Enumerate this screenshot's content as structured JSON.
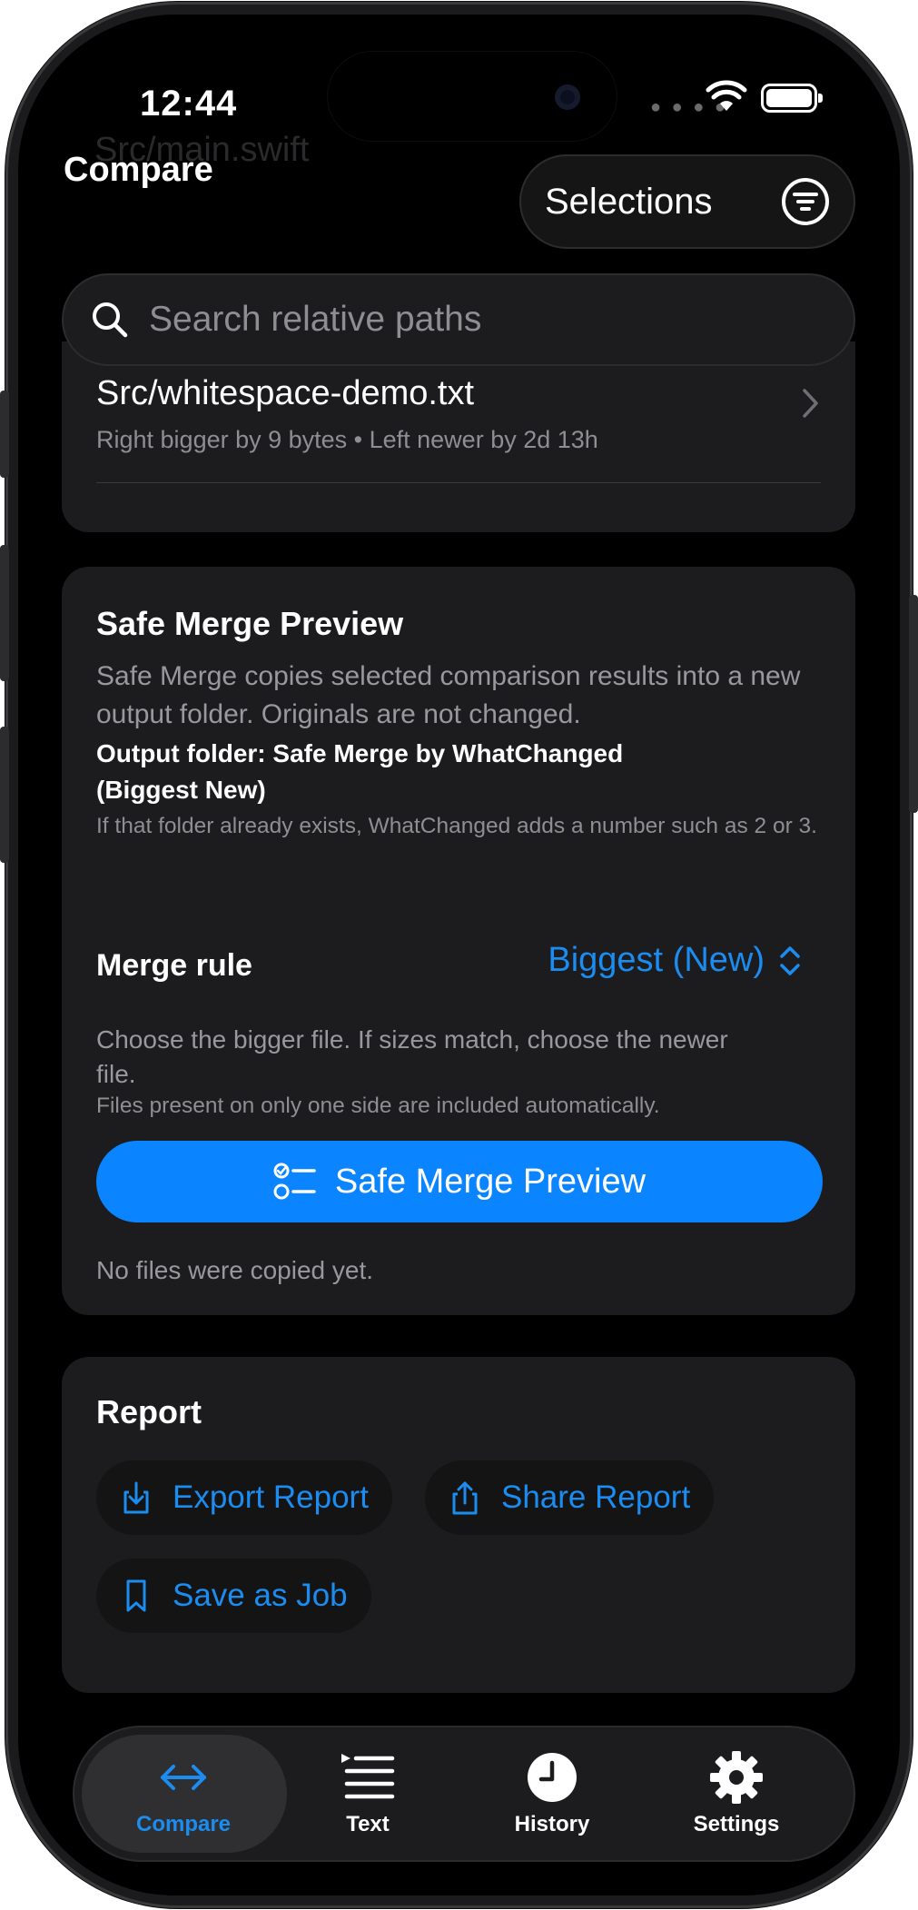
{
  "status_bar": {
    "time": "12:44"
  },
  "nav": {
    "title": "Compare",
    "selections_label": "Selections"
  },
  "search": {
    "placeholder": "Search relative paths"
  },
  "files": [
    {
      "name": "Src/whitespace-demo.txt",
      "meta": "Right bigger by 9 bytes • Left newer by 2d 13h"
    }
  ],
  "background_ghost_text": {
    "path": "Src/main.swift"
  },
  "safe_merge": {
    "title": "Safe Merge Preview",
    "description": "Safe Merge copies selected comparison results into a new output folder. Originals are not changed.",
    "output_folder": "Output folder: Safe Merge by WhatChanged (Biggest New)",
    "folder_note": "If that folder already exists, WhatChanged adds a number such as 2 or 3.",
    "merge_rule_label": "Merge rule",
    "merge_rule_value": "Biggest (New)",
    "rule_description": "Choose the bigger file. If sizes match, choose the newer file.",
    "one_side_note": "Files present on only one side are included automatically.",
    "button_label": "Safe Merge Preview",
    "status": "No files were copied yet."
  },
  "report": {
    "title": "Report",
    "export_label": "Export Report",
    "share_label": "Share Report",
    "save_job_label": "Save as Job"
  },
  "tabs": [
    {
      "label": "Compare",
      "icon": "arrows-left-right-icon",
      "active": true
    },
    {
      "label": "Text",
      "icon": "text-list-icon",
      "active": false
    },
    {
      "label": "History",
      "icon": "clock-icon",
      "active": false
    },
    {
      "label": "Settings",
      "icon": "gear-icon",
      "active": false
    }
  ],
  "colors": {
    "accent": "#0a84ff",
    "link": "#1b8cf0",
    "card": "#1c1c1e",
    "background": "#000000"
  }
}
